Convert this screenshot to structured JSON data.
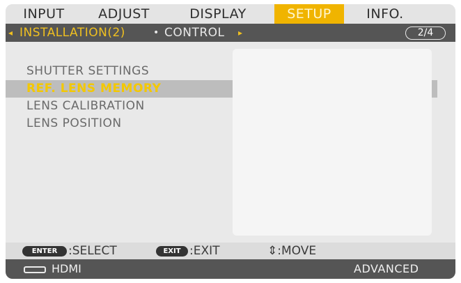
{
  "tabs": [
    {
      "label": "INPUT",
      "active": false
    },
    {
      "label": "ADJUST",
      "active": false
    },
    {
      "label": "DISPLAY",
      "active": false
    },
    {
      "label": "SETUP",
      "active": true
    },
    {
      "label": "INFO.",
      "active": false
    }
  ],
  "submenu": {
    "left_arrow": "◂",
    "active_label": "INSTALLATION(2)",
    "separator": "•",
    "next_label": "CONTROL",
    "right_arrow": "▸",
    "page_indicator": "2/4"
  },
  "menu_items": [
    {
      "label": "SHUTTER SETTINGS",
      "selected": false
    },
    {
      "label": "REF. LENS MEMORY",
      "selected": true
    },
    {
      "label": "LENS CALIBRATION",
      "selected": false
    },
    {
      "label": "LENS POSITION",
      "selected": false
    }
  ],
  "hints": {
    "enter_key": "ENTER",
    "enter_label": ":SELECT",
    "exit_key": "EXIT",
    "exit_label": ":EXIT",
    "move_label": "⇕:MOVE"
  },
  "status": {
    "source": "HDMI",
    "mode": "ADVANCED",
    "source_icon": "hdmi-connector-icon"
  },
  "colors": {
    "accent": "#f0b400",
    "selected_text": "#f4c800",
    "bar_dark": "#555555"
  }
}
